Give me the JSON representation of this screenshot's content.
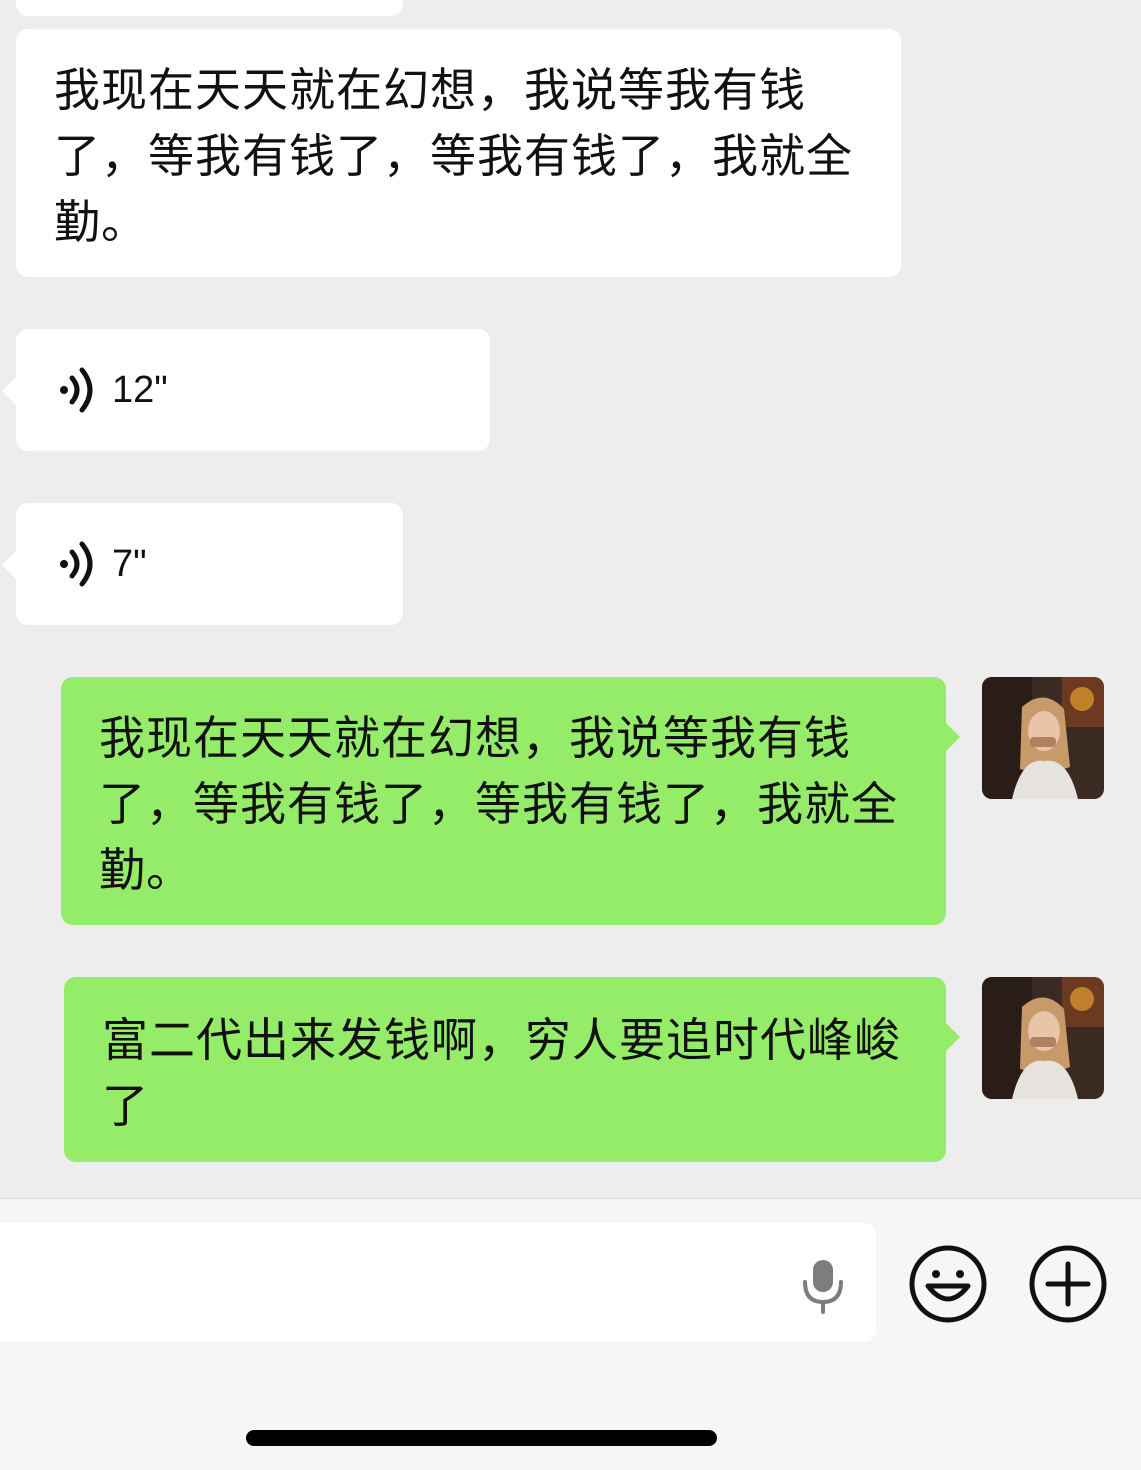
{
  "messages": [
    {
      "id": "m0",
      "side": "left",
      "type": "text",
      "text": ""
    },
    {
      "id": "m1",
      "side": "left",
      "type": "text",
      "text": "我现在天天就在幻想，我说等我有钱了，等我有钱了，等我有钱了，我就全勤。"
    },
    {
      "id": "m2",
      "side": "left",
      "type": "voice",
      "duration": "12\""
    },
    {
      "id": "m3",
      "side": "left",
      "type": "voice",
      "duration": "7\""
    },
    {
      "id": "m4",
      "side": "right",
      "type": "text",
      "text": "我现在天天就在幻想，我说等我有钱了，等我有钱了，等我有钱了，我就全勤。"
    },
    {
      "id": "m5",
      "side": "right",
      "type": "text",
      "text": "富二代出来发钱啊，穷人要追时代峰峻了"
    }
  ],
  "input": {
    "placeholder": "",
    "voice_icon": "microphone-icon",
    "emoji_icon": "emoji-smile-icon",
    "plus_icon": "plus-icon"
  },
  "colors": {
    "background": "#ededed",
    "incoming_bubble": "#ffffff",
    "outgoing_bubble": "#95ec69",
    "text": "#111111"
  }
}
